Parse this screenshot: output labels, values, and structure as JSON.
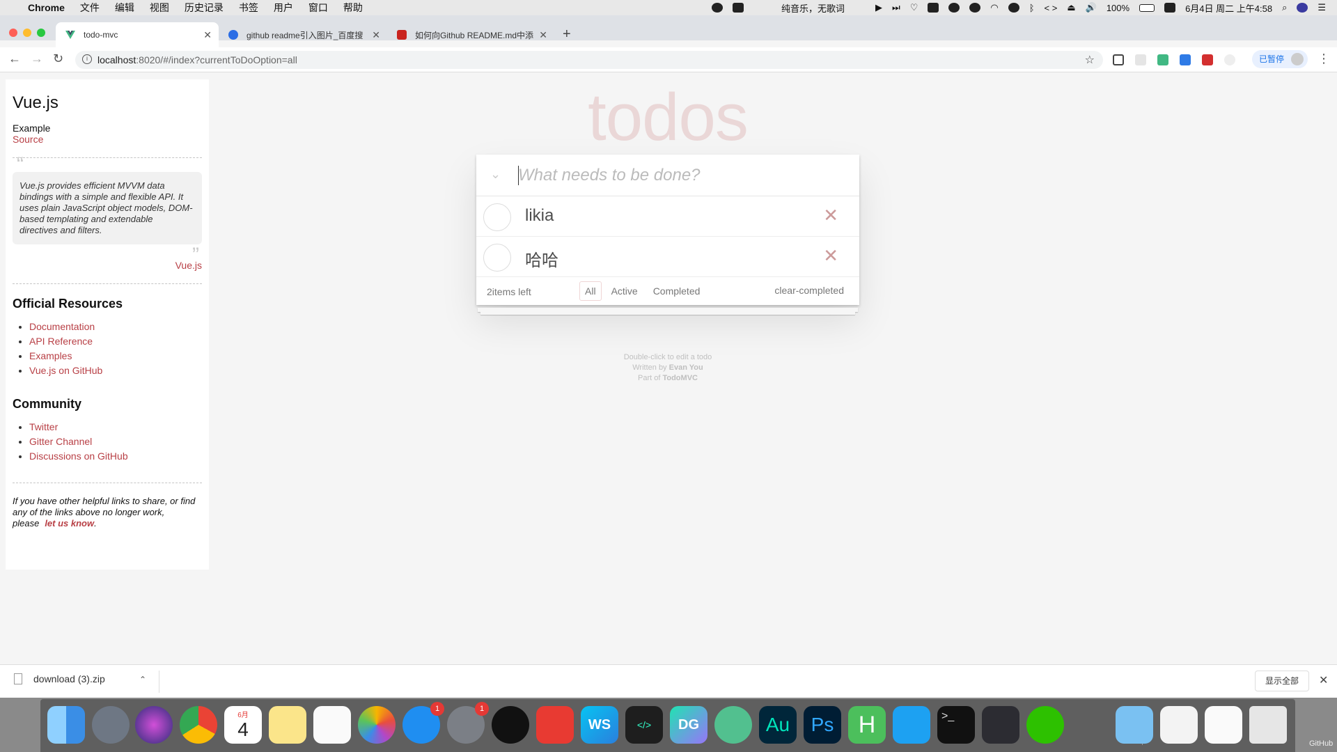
{
  "menubar": {
    "app_name": "Chrome",
    "items": [
      "文件",
      "编辑",
      "视图",
      "历史记录",
      "书签",
      "用户",
      "窗口",
      "帮助"
    ],
    "now_playing": "纯音乐，无歌词",
    "battery": "100%",
    "datetime": "6月4日 周二 上午4:58"
  },
  "browser": {
    "tabs": [
      {
        "title": "todo-mvc",
        "favicon": "vue-icon",
        "active": true
      },
      {
        "title": "github readme引入图片_百度搜",
        "favicon": "baidu-paw-icon",
        "active": false
      },
      {
        "title": "如何向Github README.md中添",
        "favicon": "csdn-icon",
        "active": false
      }
    ],
    "url_host": "localhost",
    "url_path": ":8020/#/index?currentToDoOption=all",
    "paused_label": "已暂停"
  },
  "learn": {
    "title": "Vue.js",
    "example_label": "Example",
    "source_link": "Source",
    "quote": "Vue.js provides efficient MVVM data bindings with a simple and flexible API. It uses plain JavaScript object models, DOM-based templating and extendable directives and filters.",
    "quote_footer": "Vue.js",
    "resources_heading": "Official Resources",
    "resources": [
      "Documentation",
      "API Reference",
      "Examples",
      "Vue.js on GitHub"
    ],
    "community_heading": "Community",
    "community": [
      "Twitter",
      "Gitter Channel",
      "Discussions on GitHub"
    ],
    "note": "If you have other helpful links to share, or find any of the links above no longer work, please",
    "note_link": "let us know",
    "note_end": "."
  },
  "todoapp": {
    "title": "todos",
    "placeholder": "What needs to be done?",
    "items": [
      {
        "label": "likia",
        "completed": false
      },
      {
        "label": "哈哈",
        "completed": false
      }
    ],
    "count_text": "2items left",
    "filters": [
      "All",
      "Active",
      "Completed"
    ],
    "selected_filter": "All",
    "clear_label": "clear-completed"
  },
  "info": {
    "line1": "Double-click to edit a todo",
    "written_by": "Written by",
    "author": "Evan You",
    "part_of": "Part of",
    "project": "TodoMVC"
  },
  "download": {
    "filename": "download (3).zip",
    "show_all": "显示全部"
  },
  "dock": {
    "calendar_month": "6月",
    "calendar_day": "4",
    "appstore_badge": "1",
    "prefs_badge": "1",
    "webstorm_label": "WS",
    "datagrip_label": "DG",
    "audition_label": "Au",
    "photoshop_label": "Ps",
    "hbuilder_label": "H",
    "github_label": "GitHub"
  }
}
